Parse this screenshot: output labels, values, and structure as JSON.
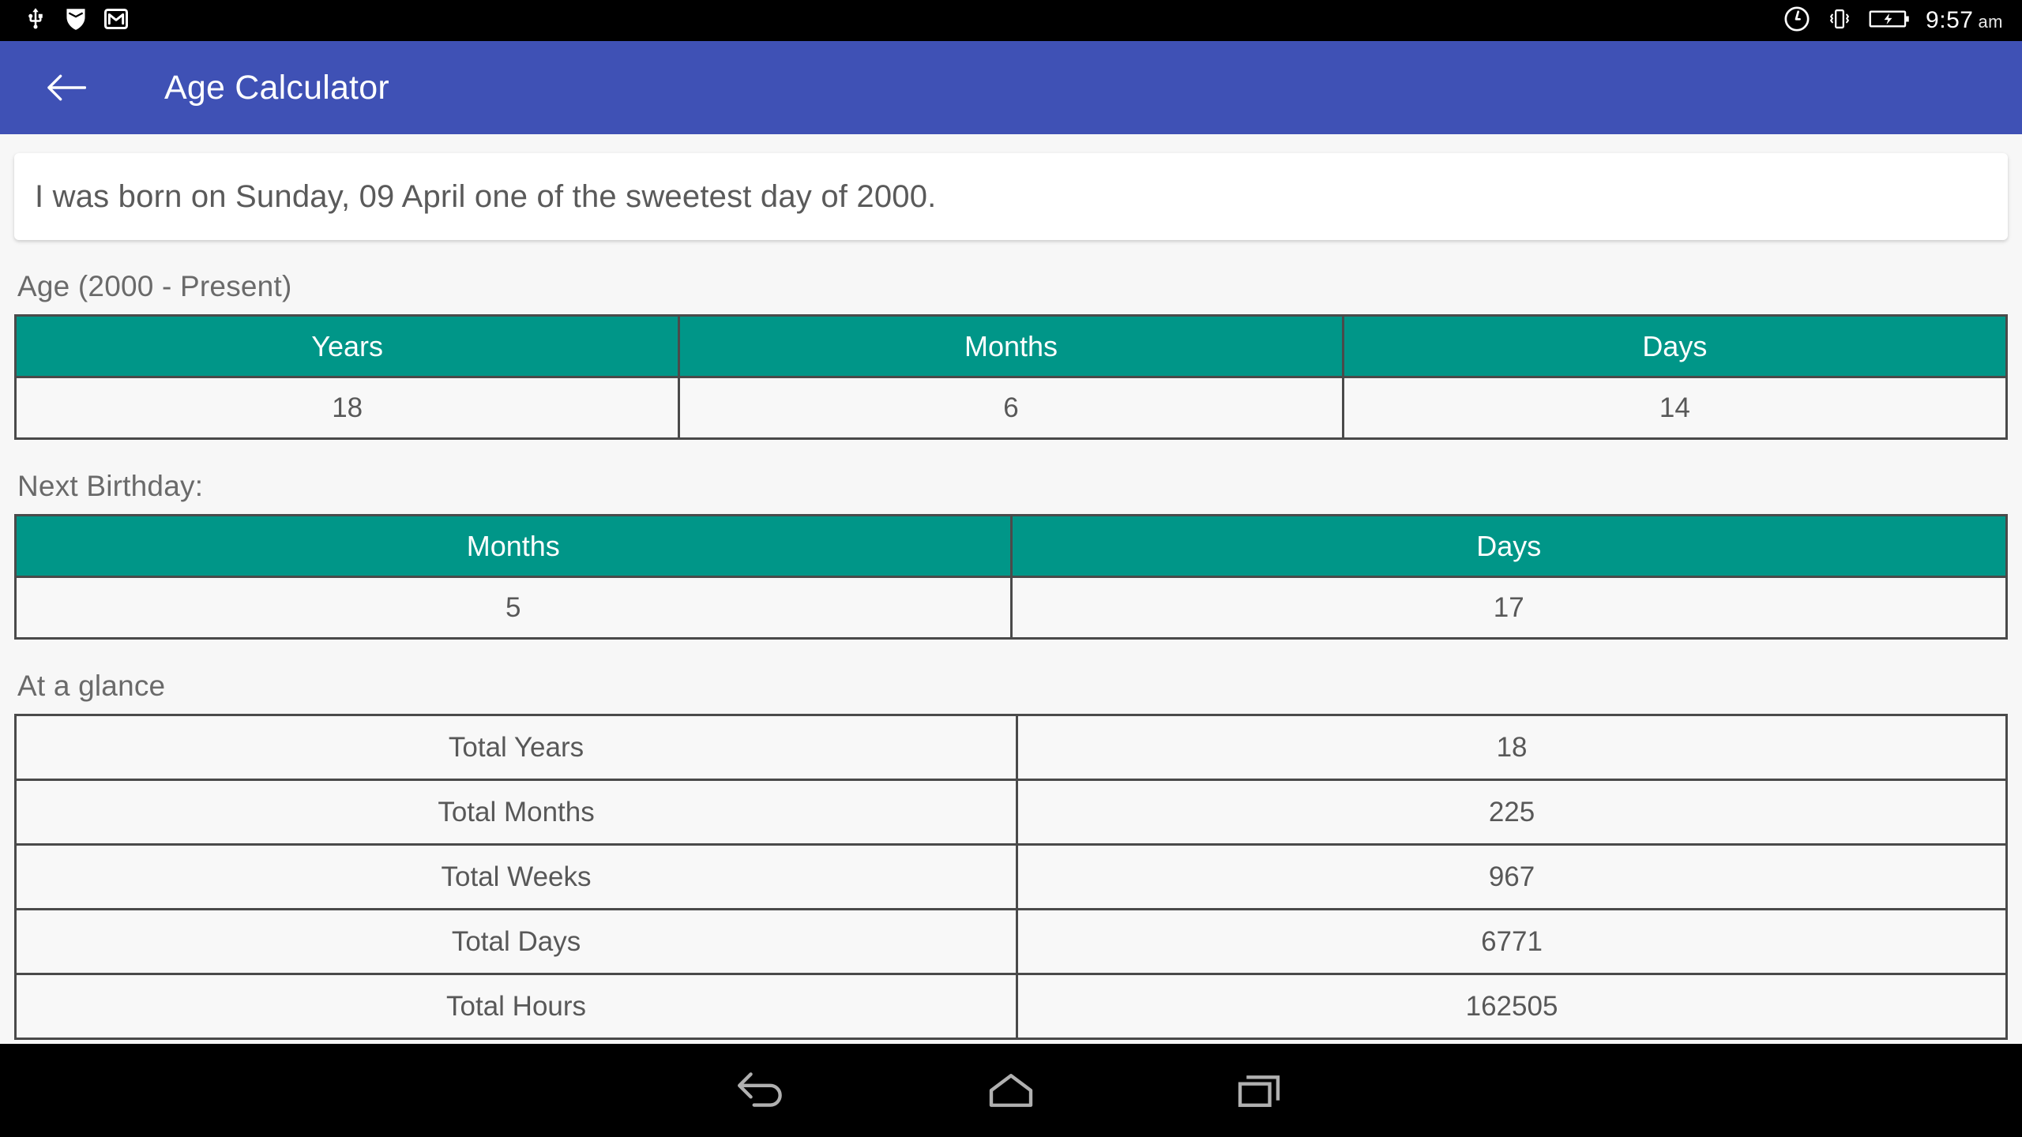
{
  "statusbar": {
    "left_icons": [
      "usb-icon",
      "shield-icon",
      "gmail-icon"
    ],
    "right_icons": [
      "alarm-clock-icon",
      "vibrate-icon",
      "battery-charging-icon"
    ],
    "time": "9:57",
    "ampm": "am"
  },
  "appbar": {
    "back_icon": "back-arrow-icon",
    "title": "Age Calculator",
    "color": "#3f51b5"
  },
  "quote": {
    "text": "I was born on Sunday, 09 April one of the sweetest day of 2000."
  },
  "age_section": {
    "title": "Age (2000 - Present)",
    "headers": [
      "Years",
      "Months",
      "Days"
    ],
    "values": [
      "18",
      "6",
      "14"
    ]
  },
  "next_birthday_section": {
    "title": "Next Birthday:",
    "headers": [
      "Months",
      "Days"
    ],
    "values": [
      "5",
      "17"
    ]
  },
  "at_a_glance_section": {
    "title": "At a glance",
    "rows": [
      {
        "label": "Total Years",
        "value": "18"
      },
      {
        "label": "Total Months",
        "value": "225"
      },
      {
        "label": "Total Weeks",
        "value": "967"
      },
      {
        "label": "Total Days",
        "value": "6771"
      },
      {
        "label": "Total Hours",
        "value": "162505"
      }
    ]
  },
  "navbar": {
    "back_label": "back-icon",
    "home_label": "home-icon",
    "recents_label": "recent-apps-icon"
  },
  "theme": {
    "accent": "#009688",
    "primary": "#3f51b5",
    "background": "#f7f7f7",
    "border": "#4a4a4a"
  }
}
